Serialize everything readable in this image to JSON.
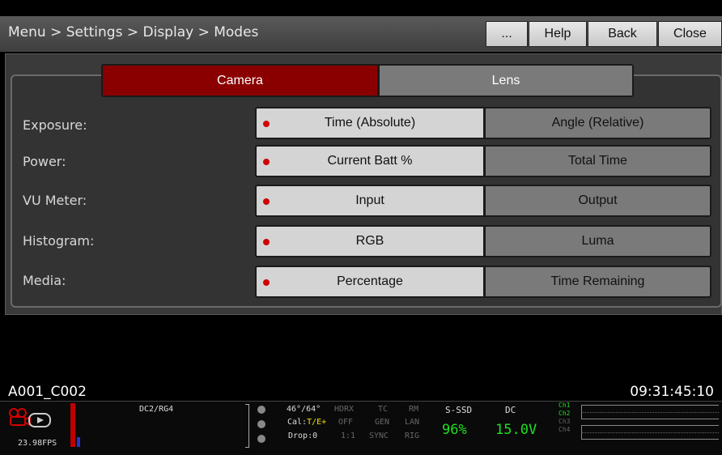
{
  "header": {
    "breadcrumb": "Menu > Settings > Display > Modes",
    "buttons": {
      "more": "...",
      "help": "Help",
      "back": "Back",
      "close": "Close"
    }
  },
  "tabs": {
    "camera": "Camera",
    "lens": "Lens",
    "active": "Camera"
  },
  "rows": [
    {
      "label": "Exposure:",
      "left": "Time (Absolute)",
      "right": "Angle (Relative)",
      "selected": "left"
    },
    {
      "label": "Power:",
      "left": "Current Batt %",
      "right": "Total Time",
      "selected": "left"
    },
    {
      "label": "VU Meter:",
      "left": "Input",
      "right": "Output",
      "selected": "left"
    },
    {
      "label": "Histogram:",
      "left": "RGB",
      "right": "Luma",
      "selected": "left"
    },
    {
      "label": "Media:",
      "left": "Percentage",
      "right": "Time Remaining",
      "selected": "left"
    }
  ],
  "footer": {
    "clip_name": "A001_C002",
    "timecode": "09:31:45:10"
  },
  "status_bar": {
    "fps": "23.98FPS",
    "look": "DC2/RG4",
    "temp": "46°/64°",
    "cal_prefix": "Cal:",
    "cal_value": "T/E+",
    "drop": "Drop:0",
    "hdrx": "HDRX",
    "hdrx_val": "OFF",
    "ratio": "1:1",
    "tc": "TC",
    "gen": "GEN",
    "sync": "SYNC",
    "rm": "RM",
    "lan": "LAN",
    "rig": "RIG",
    "media_label": "S-SSD",
    "media_value": "96%",
    "power_label": "DC",
    "power_value": "15.0V",
    "channels": [
      "Ch1",
      "Ch2",
      "Ch3",
      "Ch4"
    ]
  },
  "colors": {
    "accent": "#8a0000",
    "selected_dot": "#d00000",
    "status_green": "#1ee01e"
  }
}
